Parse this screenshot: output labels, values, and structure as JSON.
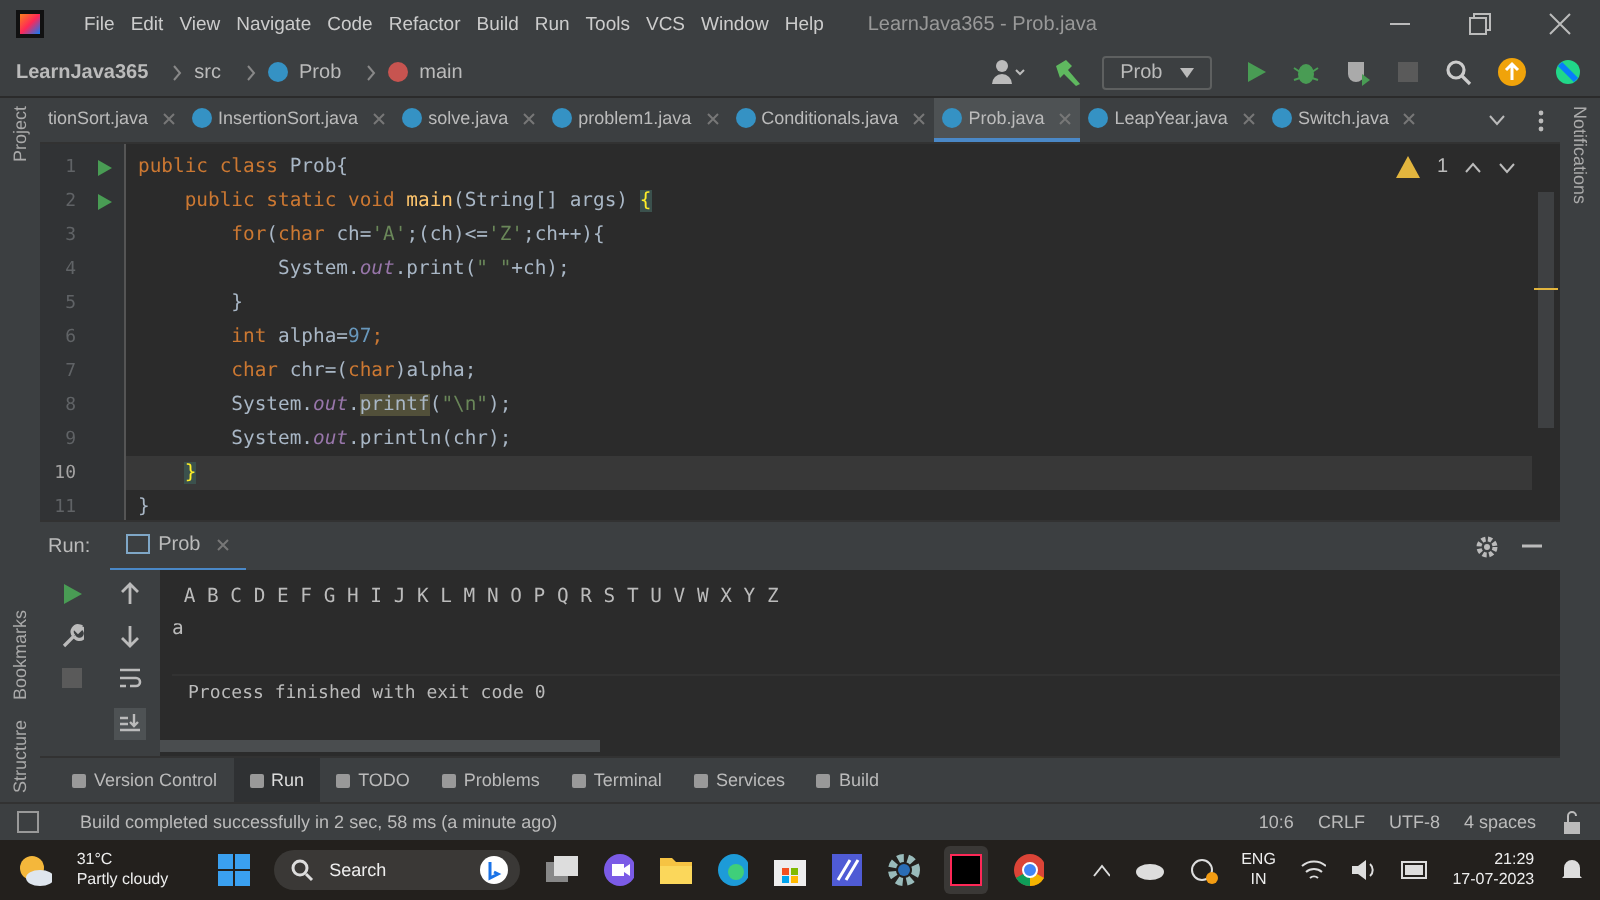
{
  "window": {
    "title": "LearnJava365 - Prob.java",
    "menu": [
      "File",
      "Edit",
      "View",
      "Navigate",
      "Code",
      "Refactor",
      "Build",
      "Run",
      "Tools",
      "VCS",
      "Window",
      "Help"
    ]
  },
  "breadcrumb": [
    "LearnJava365",
    "src",
    "Prob",
    "main"
  ],
  "run_config": "Prob",
  "tabs": [
    {
      "label": "tionSort.java",
      "selected": false
    },
    {
      "label": "InsertionSort.java",
      "selected": false
    },
    {
      "label": "solve.java",
      "selected": false
    },
    {
      "label": "problem1.java",
      "selected": false
    },
    {
      "label": "Conditionals.java",
      "selected": false
    },
    {
      "label": "Prob.java",
      "selected": true
    },
    {
      "label": "LeapYear.java",
      "selected": false
    },
    {
      "label": "Switch.java",
      "selected": false
    }
  ],
  "left_stripe": [
    "Project",
    "Bookmarks",
    "Structure"
  ],
  "right_stripe": [
    "Notifications"
  ],
  "editor": {
    "warning_count": "1",
    "lines": [
      {
        "number": "1",
        "run": true,
        "current": false,
        "tokens": [
          {
            "t": "public class ",
            "kind": "keyword"
          },
          {
            "t": "Prob{",
            "kind": "plain"
          }
        ]
      },
      {
        "number": "2",
        "run": true,
        "current": false,
        "tokens": [
          {
            "t": "    public static void ",
            "kind": "keyword"
          },
          {
            "t": "main",
            "kind": "method"
          },
          {
            "t": "(String[] args) ",
            "kind": "plain"
          },
          {
            "t": "{",
            "kind": "brace"
          }
        ]
      },
      {
        "number": "3",
        "run": false,
        "current": false,
        "tokens": [
          {
            "t": "        for",
            "kind": "keyword"
          },
          {
            "t": "(",
            "kind": "plain"
          },
          {
            "t": "char ",
            "kind": "keyword"
          },
          {
            "t": "ch=",
            "kind": "plain"
          },
          {
            "t": "'A'",
            "kind": "string"
          },
          {
            "t": ";(ch)<=",
            "kind": "plain"
          },
          {
            "t": "'Z'",
            "kind": "string"
          },
          {
            "t": ";ch++){",
            "kind": "plain"
          }
        ]
      },
      {
        "number": "4",
        "run": false,
        "current": false,
        "tokens": [
          {
            "t": "            System.",
            "kind": "plain"
          },
          {
            "t": "out",
            "kind": "field"
          },
          {
            "t": ".print(",
            "kind": "plain"
          },
          {
            "t": "\" \"",
            "kind": "string"
          },
          {
            "t": "+ch);",
            "kind": "plain"
          }
        ]
      },
      {
        "number": "5",
        "run": false,
        "current": false,
        "tokens": [
          {
            "t": "        }",
            "kind": "plain"
          }
        ]
      },
      {
        "number": "6",
        "run": false,
        "current": false,
        "tokens": [
          {
            "t": "        int ",
            "kind": "keyword"
          },
          {
            "t": "alpha=",
            "kind": "plain"
          },
          {
            "t": "97",
            "kind": "number"
          },
          {
            "t": ";",
            "kind": "keyword"
          }
        ]
      },
      {
        "number": "7",
        "run": false,
        "current": false,
        "tokens": [
          {
            "t": "        char ",
            "kind": "keyword"
          },
          {
            "t": "chr=(",
            "kind": "plain"
          },
          {
            "t": "char",
            "kind": "keyword"
          },
          {
            "t": ")alpha;",
            "kind": "plain"
          }
        ]
      },
      {
        "number": "8",
        "run": false,
        "current": false,
        "tokens": [
          {
            "t": "        System.",
            "kind": "plain"
          },
          {
            "t": "out",
            "kind": "field"
          },
          {
            "t": ".",
            "kind": "plain"
          },
          {
            "t": "printf",
            "kind": "warn"
          },
          {
            "t": "(",
            "kind": "plain"
          },
          {
            "t": "\"\\n\"",
            "kind": "string"
          },
          {
            "t": ");",
            "kind": "plain"
          }
        ]
      },
      {
        "number": "9",
        "run": false,
        "current": false,
        "tokens": [
          {
            "t": "        System.",
            "kind": "plain"
          },
          {
            "t": "out",
            "kind": "field"
          },
          {
            "t": ".println(chr);",
            "kind": "plain"
          }
        ]
      },
      {
        "number": "10",
        "run": false,
        "current": true,
        "tokens": [
          {
            "t": "    }",
            "kind": "brace"
          }
        ]
      },
      {
        "number": "11",
        "run": false,
        "current": false,
        "tokens": [
          {
            "t": "}",
            "kind": "plain"
          }
        ]
      }
    ]
  },
  "run_panel": {
    "label": "Run:",
    "tab": "Prob",
    "output": [
      {
        "text": " A B C D E F G H I J K L M N O P Q R S T U V W X Y Z",
        "kind": "stdout"
      },
      {
        "text": "a",
        "kind": "stdout"
      },
      {
        "text": "Process finished with exit code 0",
        "kind": "status"
      }
    ]
  },
  "tool_windows": [
    {
      "label": "Version Control",
      "selected": false
    },
    {
      "label": "Run",
      "selected": true
    },
    {
      "label": "TODO",
      "selected": false
    },
    {
      "label": "Problems",
      "selected": false
    },
    {
      "label": "Terminal",
      "selected": false
    },
    {
      "label": "Services",
      "selected": false
    },
    {
      "label": "Build",
      "selected": false
    }
  ],
  "status_bar": {
    "message": "Build completed successfully in 2 sec, 58 ms (a minute ago)",
    "items": [
      "10:6",
      "CRLF",
      "UTF-8",
      "4 spaces"
    ]
  },
  "taskbar": {
    "temperature": "31°C",
    "weather": "Partly cloudy",
    "search": "Search",
    "language": "ENG",
    "region": "IN",
    "time": "21:29",
    "date": "17-07-2023"
  }
}
